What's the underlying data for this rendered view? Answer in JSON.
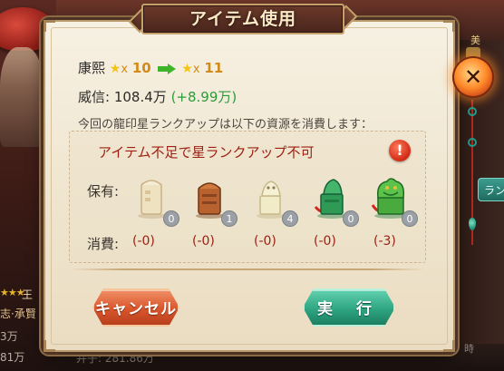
{
  "dialog": {
    "title": "アイテム使用",
    "close_label": "✕",
    "rank_line": {
      "name": "康熙",
      "from_mul": "x",
      "from_value": "10",
      "to_mul": "x",
      "to_value": "11"
    },
    "prestige_line": {
      "label": "威信:",
      "value": "108.4万",
      "gain": "(+8.99万)"
    },
    "description": "今回の龍印星ランクアップは以下の資源を消費します：",
    "warning": "アイテム不足で星ランクアップ不可",
    "warning_icon": "!",
    "owned_label": "保有:",
    "cost_label": "消費:",
    "items": [
      {
        "icon": "white-stone-seal-icon",
        "owned": "0",
        "cost": "(-0)"
      },
      {
        "icon": "bronze-seal-icon",
        "owned": "1",
        "cost": "(-0)"
      },
      {
        "icon": "ivory-tiger-seal-icon",
        "owned": "4",
        "cost": "(-0)"
      },
      {
        "icon": "jade-seal-icon",
        "owned": "0",
        "cost": "(-0)"
      },
      {
        "icon": "jade-dragon-seal-icon",
        "owned": "0",
        "cost": "(-3)"
      }
    ],
    "cancel_button": "キャンセル",
    "execute_button": "実 行"
  },
  "background": {
    "stars": "★★★",
    "char_label": "王",
    "title_text": "志·承賢",
    "value1": "3万",
    "value2": "81万",
    "value3": "弁子: 281.86万",
    "hp_text": "時",
    "side_text": "美",
    "side_button": "ラン"
  },
  "colors": {
    "warning_red": "#9c1f12",
    "gain_green": "#2d9b3a",
    "rank_gold": "#d28a1a",
    "cancel_orange": "#d9552b",
    "execute_green": "#2ea580"
  }
}
